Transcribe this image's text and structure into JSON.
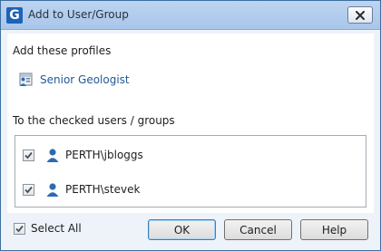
{
  "window": {
    "title": "Add to User/Group",
    "app_icon_letter": "G"
  },
  "profiles_section": {
    "label": "Add these profiles",
    "profiles": [
      {
        "label": "Senior Geologist",
        "icon": "profile-card-icon"
      }
    ]
  },
  "users_section": {
    "label": "To the checked users / groups",
    "items": [
      {
        "label": "PERTH\\jbloggs",
        "checked": true,
        "icon": "user-icon"
      },
      {
        "label": "PERTH\\stevek",
        "checked": true,
        "icon": "user-icon"
      }
    ]
  },
  "footer": {
    "select_all_label": "Select All",
    "select_all_checked": true,
    "ok_label": "OK",
    "cancel_label": "Cancel",
    "help_label": "Help"
  },
  "colors": {
    "accent": "#1d63b5",
    "link": "#1f5a96",
    "user_icon": "#2e6ab3"
  }
}
